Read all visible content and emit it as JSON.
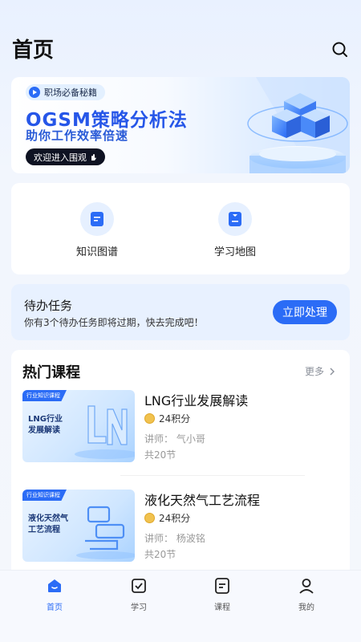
{
  "header": {
    "title": "首页",
    "search_icon": "search-icon"
  },
  "banner": {
    "tag": "职场必备秘籍",
    "title": "OGSM策略分析法",
    "subtitle": "助你工作效率倍速",
    "cta": "欢迎进入围观"
  },
  "shortcuts": [
    {
      "label": "知识图谱",
      "icon": "knowledge-graph-icon"
    },
    {
      "label": "学习地图",
      "icon": "learning-map-icon"
    }
  ],
  "task": {
    "title": "待办任务",
    "description": "你有3个待办任务即将过期，快去完成吧！",
    "button": "立即处理"
  },
  "courses": {
    "title": "热门课程",
    "more": "更多",
    "items": [
      {
        "thumb_tag": "行业知识课程",
        "thumb_line1": "LNG行业",
        "thumb_line2": "发展解读",
        "name": "LNG行业发展解读",
        "credits": "24积分",
        "teacher": "讲师：  气小哥",
        "lessons": "共20节"
      },
      {
        "thumb_tag": "行业知识课程",
        "thumb_line1": "液化天然气",
        "thumb_line2": "工艺流程",
        "name": "液化天然气工艺流程",
        "credits": "24积分",
        "teacher": "讲师：  杨波铭",
        "lessons": "共20节"
      }
    ]
  },
  "nav": [
    {
      "label": "首页",
      "icon": "home-icon",
      "active": true
    },
    {
      "label": "学习",
      "icon": "study-icon",
      "active": false
    },
    {
      "label": "课程",
      "icon": "course-icon",
      "active": false
    },
    {
      "label": "我的",
      "icon": "profile-icon",
      "active": false
    }
  ],
  "colors": {
    "primary": "#2b6cf6",
    "banner_title": "#2656e8",
    "task_bg": "#e8f1ff"
  }
}
